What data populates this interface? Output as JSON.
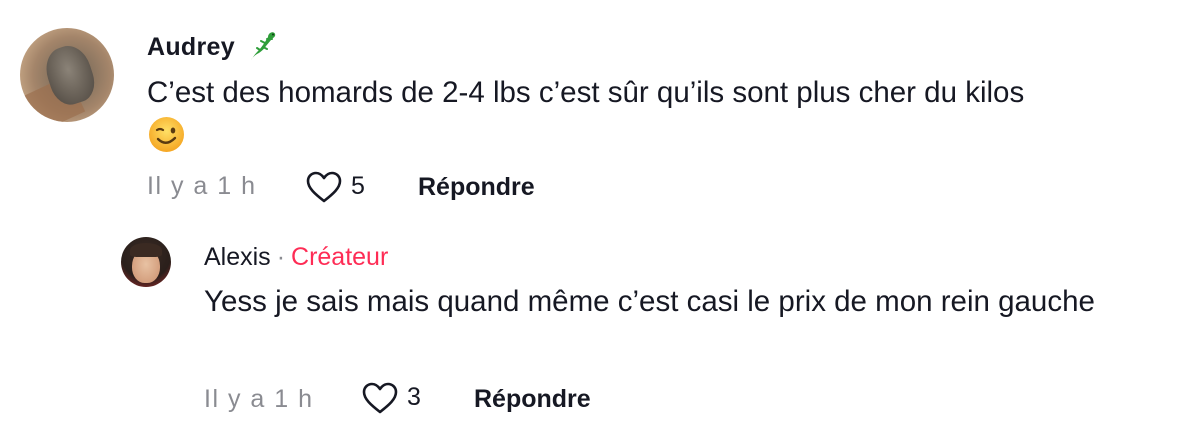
{
  "comments": [
    {
      "author": "Audrey",
      "author_emoji": "lizard-icon",
      "text": "C’est des homards de 2-4 lbs c’est sûr qu’ils sont plus cher du kilos",
      "trailing_emoji": "winking-face-icon",
      "time": "Il y a 1 h",
      "likes": "5",
      "reply_label": "Répondre"
    },
    {
      "author": "Alexis",
      "separator": "·",
      "badge": "Créateur",
      "text": "Yess je sais mais quand même c’est casi le prix de mon rein gauche",
      "time": "Il y a 1 h",
      "likes": "3",
      "reply_label": "Répondre"
    }
  ],
  "colors": {
    "text": "#161823",
    "muted": "#8a8b91",
    "creator_badge": "#fe2c55"
  }
}
